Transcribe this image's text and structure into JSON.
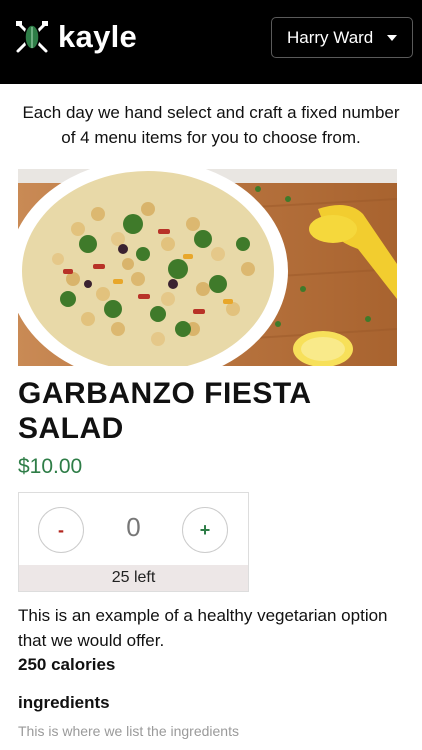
{
  "header": {
    "logo_text": "kayle",
    "user_name": "Harry Ward"
  },
  "intro": {
    "line1": "Each day we hand select and craft a fixed number",
    "line2": "of 4 menu items for you to choose from."
  },
  "item": {
    "title_line1": "GARBANZO FIESTA",
    "title_line2": "SALAD",
    "price": "$10.00",
    "quantity": "0",
    "minus_label": "-",
    "plus_label": "+",
    "remaining": "25 left",
    "description_line1": "This is an example of a healthy vegetarian option",
    "description_line2": "that we would offer.",
    "calories": "250 calories",
    "ingredients_heading": "ingredients",
    "ingredients_text": "This is where we list the ingredients"
  },
  "colors": {
    "header_bg": "#000000",
    "price": "#2e7d47",
    "minus": "#b3261e",
    "plus": "#2e7d47",
    "remaining_bg": "#ede7e7"
  },
  "icons": {
    "logo": "leaf-fork-knife-icon",
    "dropdown": "caret-down-icon"
  }
}
